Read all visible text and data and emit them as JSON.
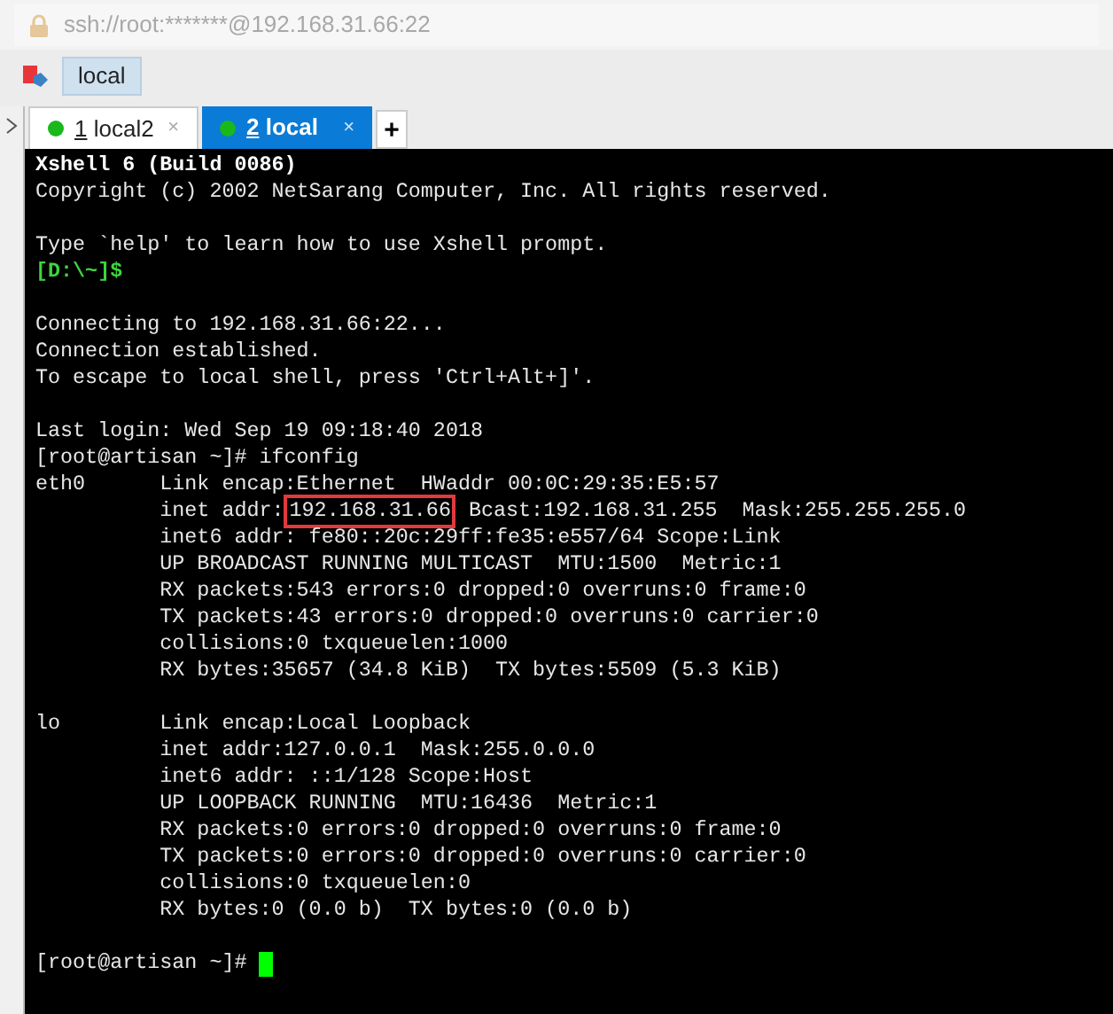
{
  "address_bar": {
    "url": "ssh://root:*******@192.168.31.66:22"
  },
  "toolbar": {
    "session_button": "local"
  },
  "tabs": [
    {
      "number": "1",
      "label": "local2",
      "selected": false,
      "close": "×"
    },
    {
      "number": "2",
      "label": "local",
      "selected": true,
      "close": "×"
    }
  ],
  "new_tab": "+",
  "terminal": {
    "lines": [
      {
        "kind": "bold",
        "segments": [
          {
            "kind": "text",
            "text": "Xshell 6 (Build 0086)"
          }
        ]
      },
      {
        "kind": "plain",
        "segments": [
          {
            "kind": "text",
            "text": "Copyright (c) 2002 NetSarang Computer, Inc. All rights reserved."
          }
        ]
      },
      {
        "kind": "blank"
      },
      {
        "kind": "plain",
        "segments": [
          {
            "kind": "text",
            "text": "Type `help' to learn how to use Xshell prompt."
          }
        ]
      },
      {
        "kind": "prompt",
        "segments": [
          {
            "kind": "text",
            "text": "[D:\\~]$"
          }
        ]
      },
      {
        "kind": "blank"
      },
      {
        "kind": "plain",
        "segments": [
          {
            "kind": "text",
            "text": "Connecting to 192.168.31.66:22..."
          }
        ]
      },
      {
        "kind": "plain",
        "segments": [
          {
            "kind": "text",
            "text": "Connection established."
          }
        ]
      },
      {
        "kind": "plain",
        "segments": [
          {
            "kind": "text",
            "text": "To escape to local shell, press 'Ctrl+Alt+]'."
          }
        ]
      },
      {
        "kind": "blank"
      },
      {
        "kind": "plain",
        "segments": [
          {
            "kind": "text",
            "text": "Last login: Wed Sep 19 09:18:40 2018"
          }
        ]
      },
      {
        "kind": "plain",
        "segments": [
          {
            "kind": "text",
            "text": "[root@artisan ~]# ifconfig"
          }
        ]
      },
      {
        "kind": "plain",
        "segments": [
          {
            "kind": "text",
            "text": "eth0      Link encap:Ethernet  HWaddr 00:0C:29:35:E5:57"
          }
        ]
      },
      {
        "kind": "plain",
        "segments": [
          {
            "kind": "text",
            "text": "          inet addr:"
          },
          {
            "kind": "highlight",
            "text": "192.168.31.66"
          },
          {
            "kind": "text",
            "text": " Bcast:192.168.31.255  Mask:255.255.255.0"
          }
        ]
      },
      {
        "kind": "plain",
        "segments": [
          {
            "kind": "text",
            "text": "          inet6 addr: fe80::20c:29ff:fe35:e557/64 Scope:Link"
          }
        ]
      },
      {
        "kind": "plain",
        "segments": [
          {
            "kind": "text",
            "text": "          UP BROADCAST RUNNING MULTICAST  MTU:1500  Metric:1"
          }
        ]
      },
      {
        "kind": "plain",
        "segments": [
          {
            "kind": "text",
            "text": "          RX packets:543 errors:0 dropped:0 overruns:0 frame:0"
          }
        ]
      },
      {
        "kind": "plain",
        "segments": [
          {
            "kind": "text",
            "text": "          TX packets:43 errors:0 dropped:0 overruns:0 carrier:0"
          }
        ]
      },
      {
        "kind": "plain",
        "segments": [
          {
            "kind": "text",
            "text": "          collisions:0 txqueuelen:1000"
          }
        ]
      },
      {
        "kind": "plain",
        "segments": [
          {
            "kind": "text",
            "text": "          RX bytes:35657 (34.8 KiB)  TX bytes:5509 (5.3 KiB)"
          }
        ]
      },
      {
        "kind": "blank"
      },
      {
        "kind": "plain",
        "segments": [
          {
            "kind": "text",
            "text": "lo        Link encap:Local Loopback"
          }
        ]
      },
      {
        "kind": "plain",
        "segments": [
          {
            "kind": "text",
            "text": "          inet addr:127.0.0.1  Mask:255.0.0.0"
          }
        ]
      },
      {
        "kind": "plain",
        "segments": [
          {
            "kind": "text",
            "text": "          inet6 addr: ::1/128 Scope:Host"
          }
        ]
      },
      {
        "kind": "plain",
        "segments": [
          {
            "kind": "text",
            "text": "          UP LOOPBACK RUNNING  MTU:16436  Metric:1"
          }
        ]
      },
      {
        "kind": "plain",
        "segments": [
          {
            "kind": "text",
            "text": "          RX packets:0 errors:0 dropped:0 overruns:0 frame:0"
          }
        ]
      },
      {
        "kind": "plain",
        "segments": [
          {
            "kind": "text",
            "text": "          TX packets:0 errors:0 dropped:0 overruns:0 carrier:0"
          }
        ]
      },
      {
        "kind": "plain",
        "segments": [
          {
            "kind": "text",
            "text": "          collisions:0 txqueuelen:0"
          }
        ]
      },
      {
        "kind": "plain",
        "segments": [
          {
            "kind": "text",
            "text": "          RX bytes:0 (0.0 b)  TX bytes:0 (0.0 b)"
          }
        ]
      },
      {
        "kind": "blank"
      },
      {
        "kind": "plain",
        "segments": [
          {
            "kind": "text",
            "text": "[root@artisan ~]# "
          },
          {
            "kind": "cursor"
          }
        ]
      }
    ]
  }
}
